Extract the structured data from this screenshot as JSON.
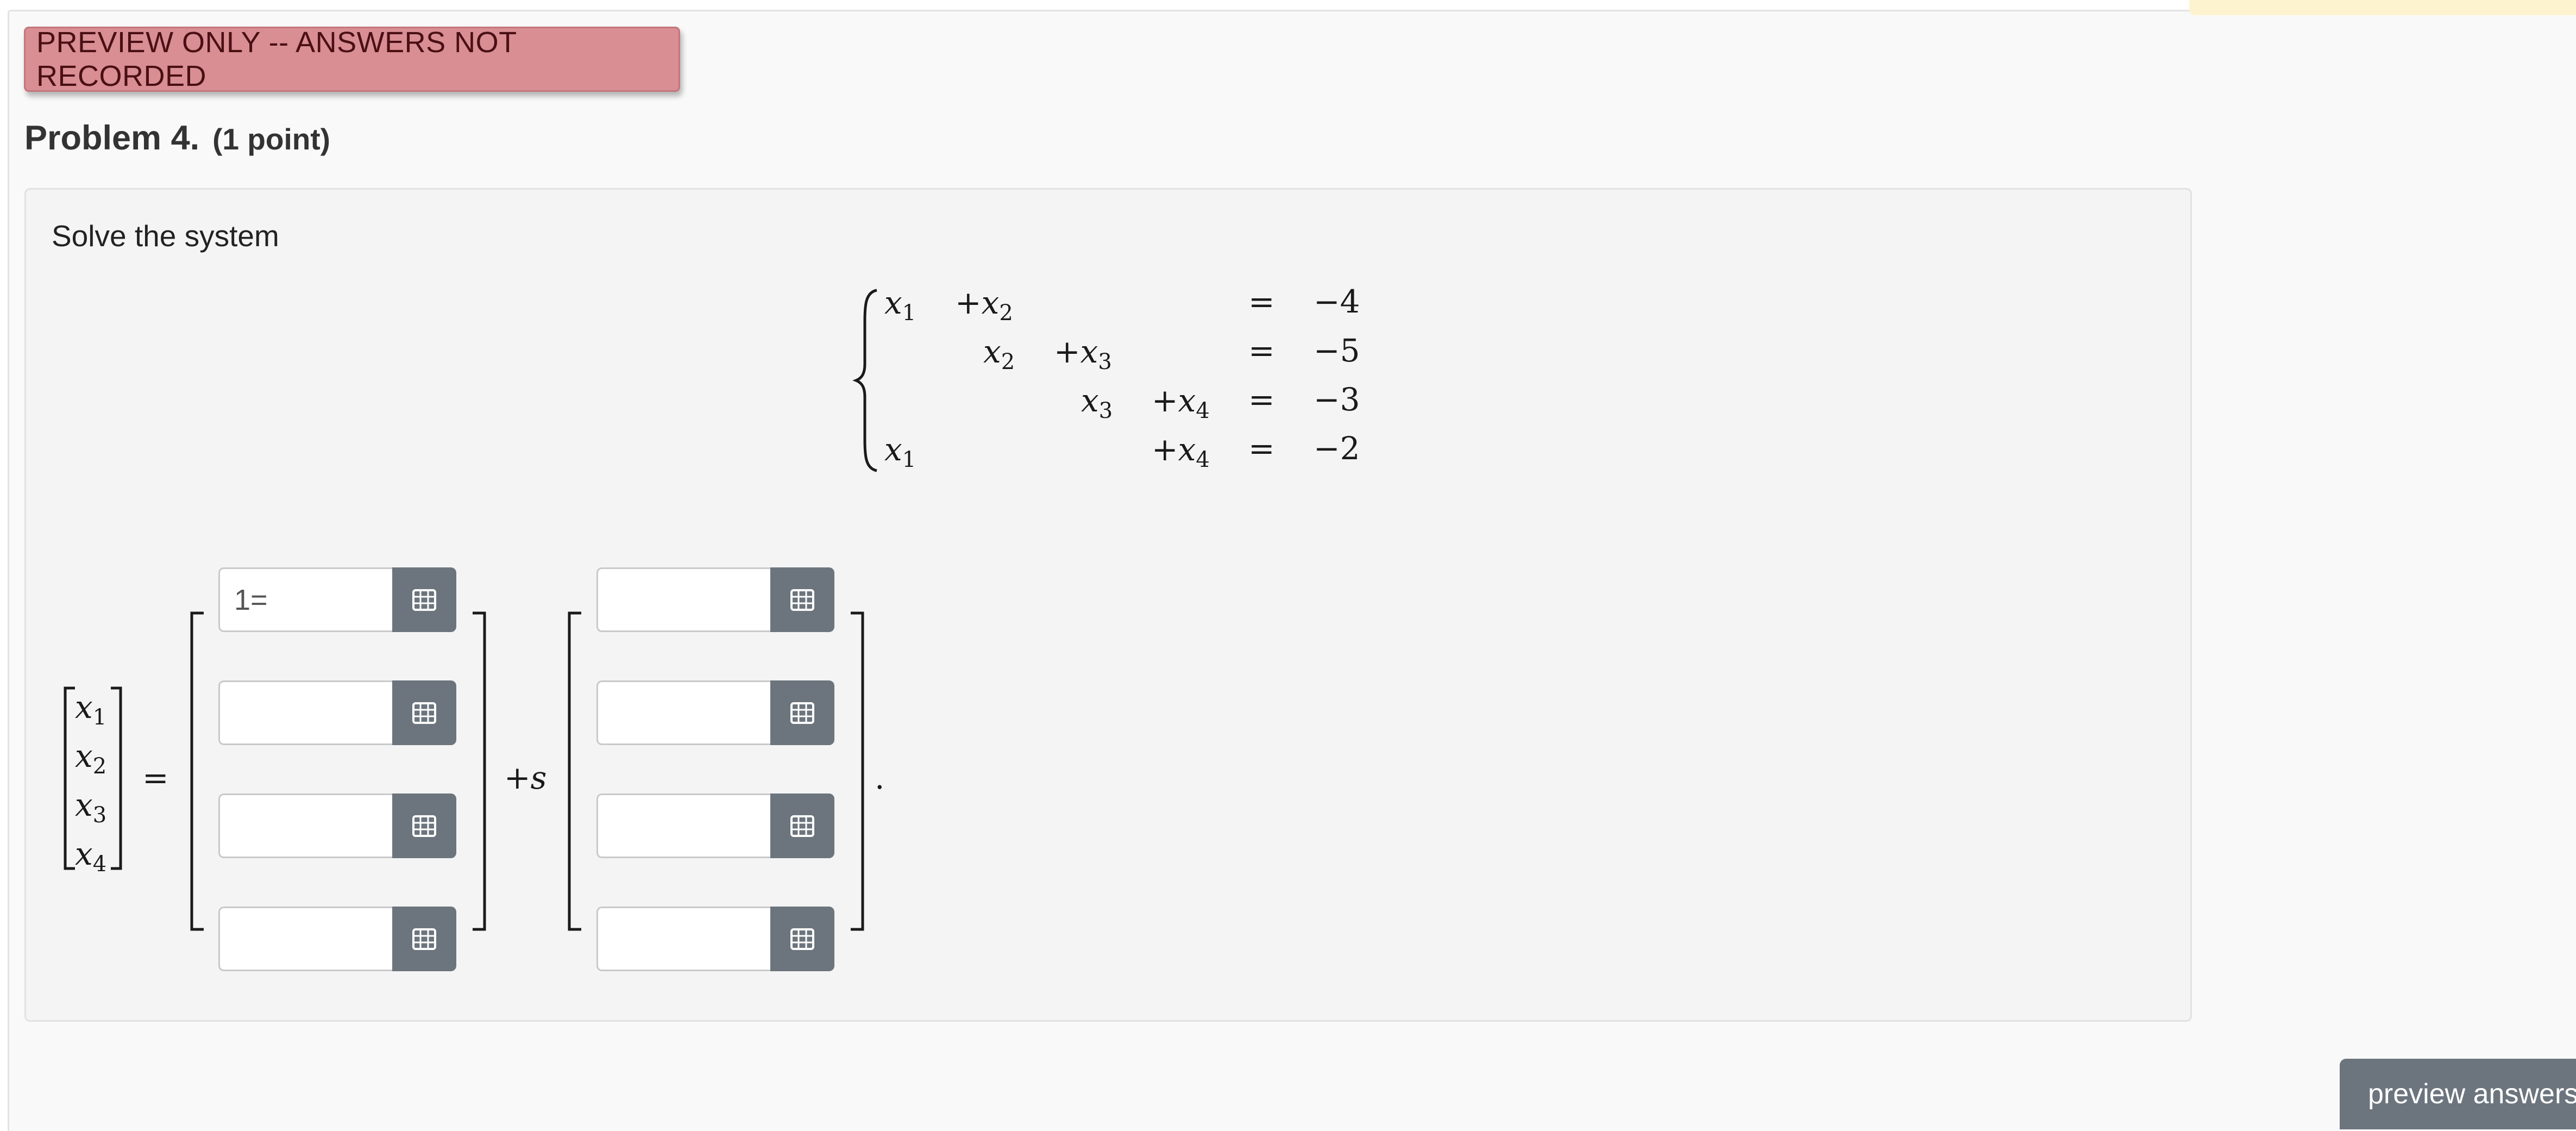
{
  "banner": {
    "text": "PREVIEW ONLY -- ANSWERS NOT RECORDED"
  },
  "problem": {
    "number_label": "Problem 4.",
    "points_label": "(1 point)",
    "instruction": "Solve the system"
  },
  "system": {
    "rows": [
      {
        "terms": [
          "x1",
          "+x2",
          "",
          ""
        ],
        "rhs": "−4"
      },
      {
        "terms": [
          "",
          "x2",
          "+x3",
          ""
        ],
        "rhs": "−5"
      },
      {
        "terms": [
          "",
          "",
          "x3",
          "+x4"
        ],
        "rhs": "−3"
      },
      {
        "terms": [
          "x1",
          "",
          "",
          "+x4"
        ],
        "rhs": "−2"
      }
    ],
    "equals": "="
  },
  "answer": {
    "vector": [
      "x1",
      "x2",
      "x3",
      "x4"
    ],
    "equals": "=",
    "plus_s": "+s",
    "period": ".",
    "particular": [
      {
        "value": "1=",
        "placeholder": ""
      },
      {
        "value": "",
        "placeholder": ""
      },
      {
        "value": "",
        "placeholder": ""
      },
      {
        "value": "",
        "placeholder": ""
      }
    ],
    "direction": [
      {
        "value": "",
        "placeholder": ""
      },
      {
        "value": "",
        "placeholder": ""
      },
      {
        "value": "",
        "placeholder": ""
      },
      {
        "value": "",
        "placeholder": ""
      }
    ],
    "field_button_icon": "matrix-grid-icon"
  },
  "actions": {
    "preview_answers_label": "preview answers"
  },
  "colors": {
    "banner_bg": "#d88e93",
    "panel_bg": "#f4f4f4",
    "button_bg": "#6c757d",
    "note_bg": "#fdf3cf"
  }
}
